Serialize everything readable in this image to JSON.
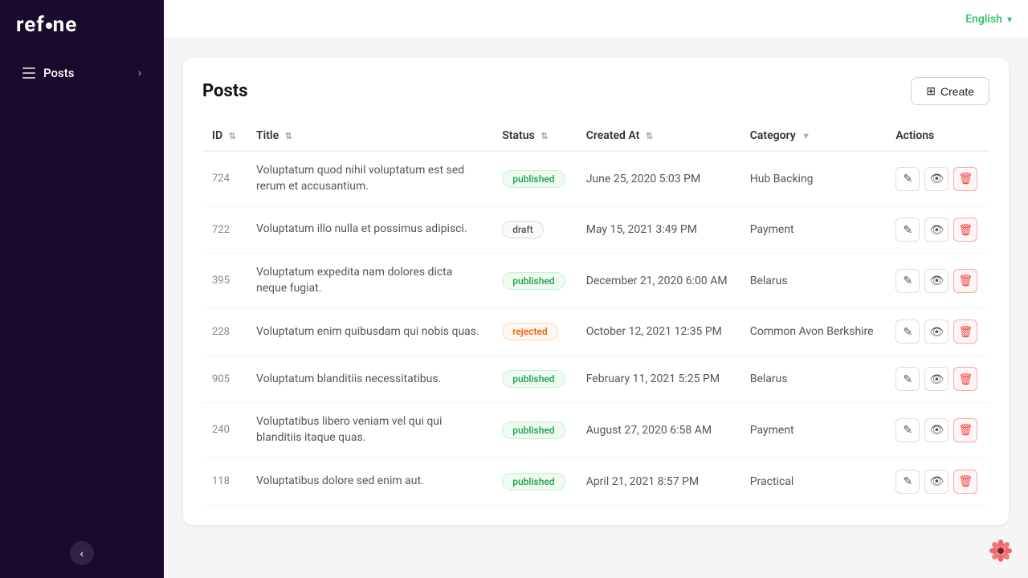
{
  "app": {
    "name": "refine"
  },
  "sidebar": {
    "nav_items": [
      {
        "id": "posts",
        "label": "Posts",
        "icon": "hamburger-icon"
      }
    ]
  },
  "topbar": {
    "language": "English",
    "lang_chevron": "▾"
  },
  "page": {
    "title": "Posts",
    "create_button_label": "Create",
    "create_icon": "+"
  },
  "table": {
    "columns": [
      {
        "id": "id",
        "label": "ID",
        "sortable": true
      },
      {
        "id": "title",
        "label": "Title",
        "sortable": true
      },
      {
        "id": "status",
        "label": "Status",
        "sortable": true
      },
      {
        "id": "created_at",
        "label": "Created At",
        "sortable": true
      },
      {
        "id": "category",
        "label": "Category",
        "filterable": true
      },
      {
        "id": "actions",
        "label": "Actions",
        "sortable": false
      }
    ],
    "rows": [
      {
        "id": "724",
        "title": "Voluptatum quod nihil voluptatum est sed rerum et accusantium.",
        "status": "published",
        "created_at": "June 25, 2020 5:03 PM",
        "category": "Hub Backing"
      },
      {
        "id": "722",
        "title": "Voluptatum illo nulla et possimus adipisci.",
        "status": "draft",
        "created_at": "May 15, 2021 3:49 PM",
        "category": "Payment"
      },
      {
        "id": "395",
        "title": "Voluptatum expedita nam dolores dicta neque fugiat.",
        "status": "published",
        "created_at": "December 21, 2020 6:00 AM",
        "category": "Belarus"
      },
      {
        "id": "228",
        "title": "Voluptatum enim quibusdam qui nobis quas.",
        "status": "rejected",
        "created_at": "October 12, 2021 12:35 PM",
        "category": "Common Avon Berkshire"
      },
      {
        "id": "905",
        "title": "Voluptatum blanditiis necessitatibus.",
        "status": "published",
        "created_at": "February 11, 2021 5:25 PM",
        "category": "Belarus"
      },
      {
        "id": "240",
        "title": "Voluptatibus libero veniam vel qui qui blanditiis itaque quas.",
        "status": "published",
        "created_at": "August 27, 2020 6:58 AM",
        "category": "Payment"
      },
      {
        "id": "118",
        "title": "Voluptatibus dolore sed enim aut.",
        "status": "published",
        "created_at": "April 21, 2021 8:57 PM",
        "category": "Practical"
      }
    ]
  }
}
